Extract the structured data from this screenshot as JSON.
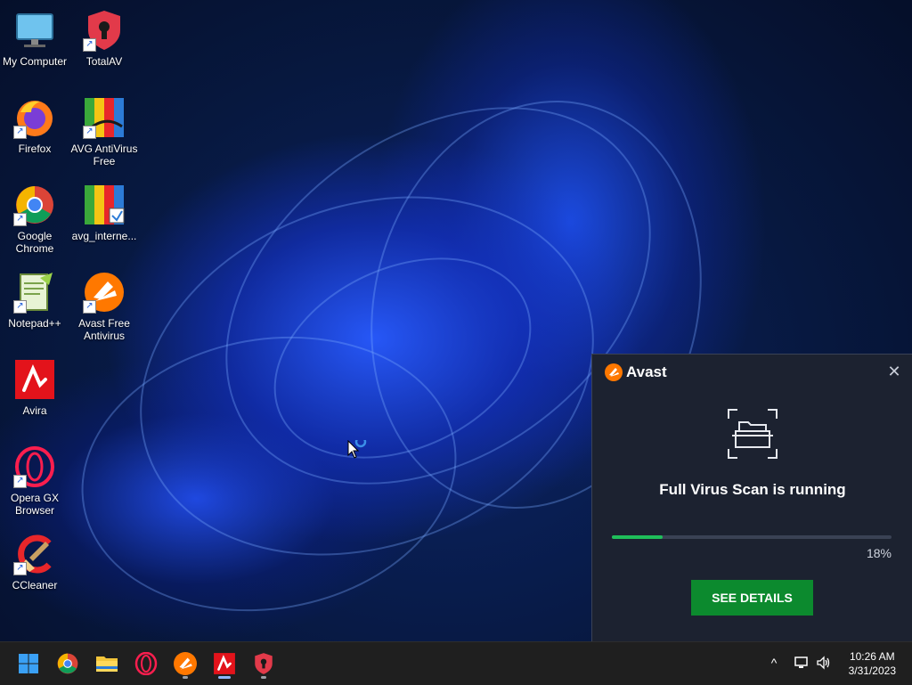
{
  "desktop": {
    "icons": [
      {
        "label": "My Computer"
      },
      {
        "label": "TotalAV"
      },
      {
        "label": "Firefox"
      },
      {
        "label": "AVG AntiVirus Free"
      },
      {
        "label": "Google Chrome"
      },
      {
        "label": "avg_interne..."
      },
      {
        "label": "Notepad++"
      },
      {
        "label": "Avast Free Antivirus"
      },
      {
        "label": "Avira"
      },
      {
        "label": "Opera GX Browser"
      },
      {
        "label": "CCleaner"
      }
    ]
  },
  "avast_popup": {
    "brand": "Avast",
    "close_label": "✕",
    "title": "Full Virus Scan is running",
    "progress_percent": 18,
    "progress_text": "18%",
    "button_label": "SEE DETAILS",
    "accent_color": "#0c8a2e",
    "progress_color": "#1fbf5a"
  },
  "taskbar": {
    "apps": [
      "start-icon",
      "chrome-icon",
      "file-explorer-icon",
      "opera-icon",
      "avast-icon",
      "avira-icon",
      "totalav-icon"
    ],
    "tray": {
      "chevron": "^",
      "network": "network-icon",
      "volume": "volume-icon"
    },
    "clock": {
      "time": "10:26 AM",
      "date": "3/31/2023"
    }
  }
}
